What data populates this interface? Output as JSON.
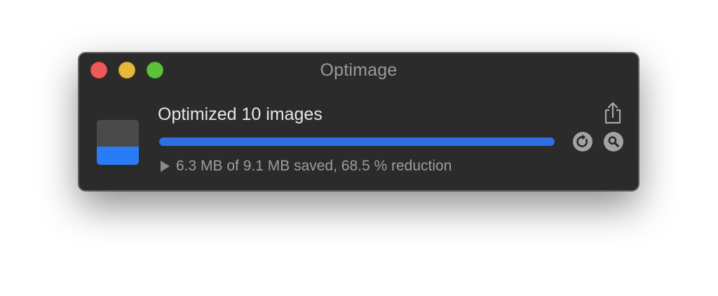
{
  "window": {
    "title": "Optimage"
  },
  "status": {
    "title": "Optimized 10 images",
    "summary": "6.3 MB of 9.1 MB saved, 68.5 % reduction",
    "progress_fraction": 1.0
  },
  "icons": {
    "document": "image-document-icon",
    "share": "share-icon",
    "reload": "reload-icon",
    "search": "magnifier-icon",
    "disclosure": "disclosure-triangle-icon"
  },
  "colors": {
    "window_bg": "#2b2b2b",
    "progress": "#2f6fe4",
    "close": "#ee5a57",
    "minimize": "#e5b83a",
    "zoom": "#5cc13b"
  }
}
